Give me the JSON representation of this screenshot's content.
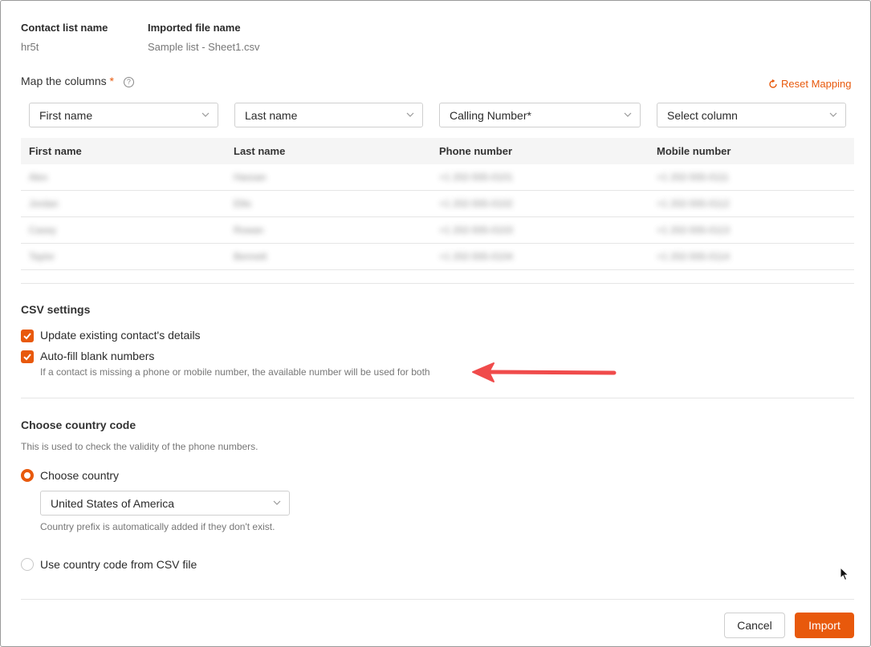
{
  "header": {
    "contact_list_label": "Contact list name",
    "contact_list_value": "hr5t",
    "imported_file_label": "Imported file name",
    "imported_file_value": "Sample list - Sheet1.csv"
  },
  "mapping": {
    "title": "Map the columns",
    "required_mark": "*",
    "help_glyph": "?",
    "reset_label": "Reset Mapping",
    "selects": [
      {
        "value": "First name"
      },
      {
        "value": "Last name"
      },
      {
        "value": "Calling Number*"
      },
      {
        "value": "Select column"
      }
    ],
    "headers": [
      "First name",
      "Last name",
      "Phone number",
      "Mobile number"
    ],
    "rows": [
      [
        "Alex",
        "Hassan",
        "+1 202-555-0101",
        "+1 202-555-0111"
      ],
      [
        "Jordan",
        "Ellis",
        "+1 202-555-0102",
        "+1 202-555-0112"
      ],
      [
        "Casey",
        "Rowan",
        "+1 202-555-0103",
        "+1 202-555-0113"
      ],
      [
        "Taylor",
        "Bennett",
        "+1 202-555-0104",
        "+1 202-555-0114"
      ]
    ]
  },
  "csv_settings": {
    "title": "CSV settings",
    "update_label": "Update existing contact's details",
    "update_checked": true,
    "autofill_label": "Auto-fill blank numbers",
    "autofill_checked": true,
    "autofill_hint": "If a contact is missing a phone or mobile number, the available number will be used for both"
  },
  "country": {
    "title": "Choose country code",
    "description": "This is used to check the validity of the phone numbers.",
    "choose_label": "Choose country",
    "selected_country": "United States of America",
    "prefix_hint": "Country prefix is automatically added if they don't exist.",
    "csv_option_label": "Use country code from CSV file"
  },
  "footer": {
    "cancel_label": "Cancel",
    "import_label": "Import"
  },
  "colors": {
    "accent": "#e8590c",
    "annotation_arrow": "#f04b4b"
  }
}
